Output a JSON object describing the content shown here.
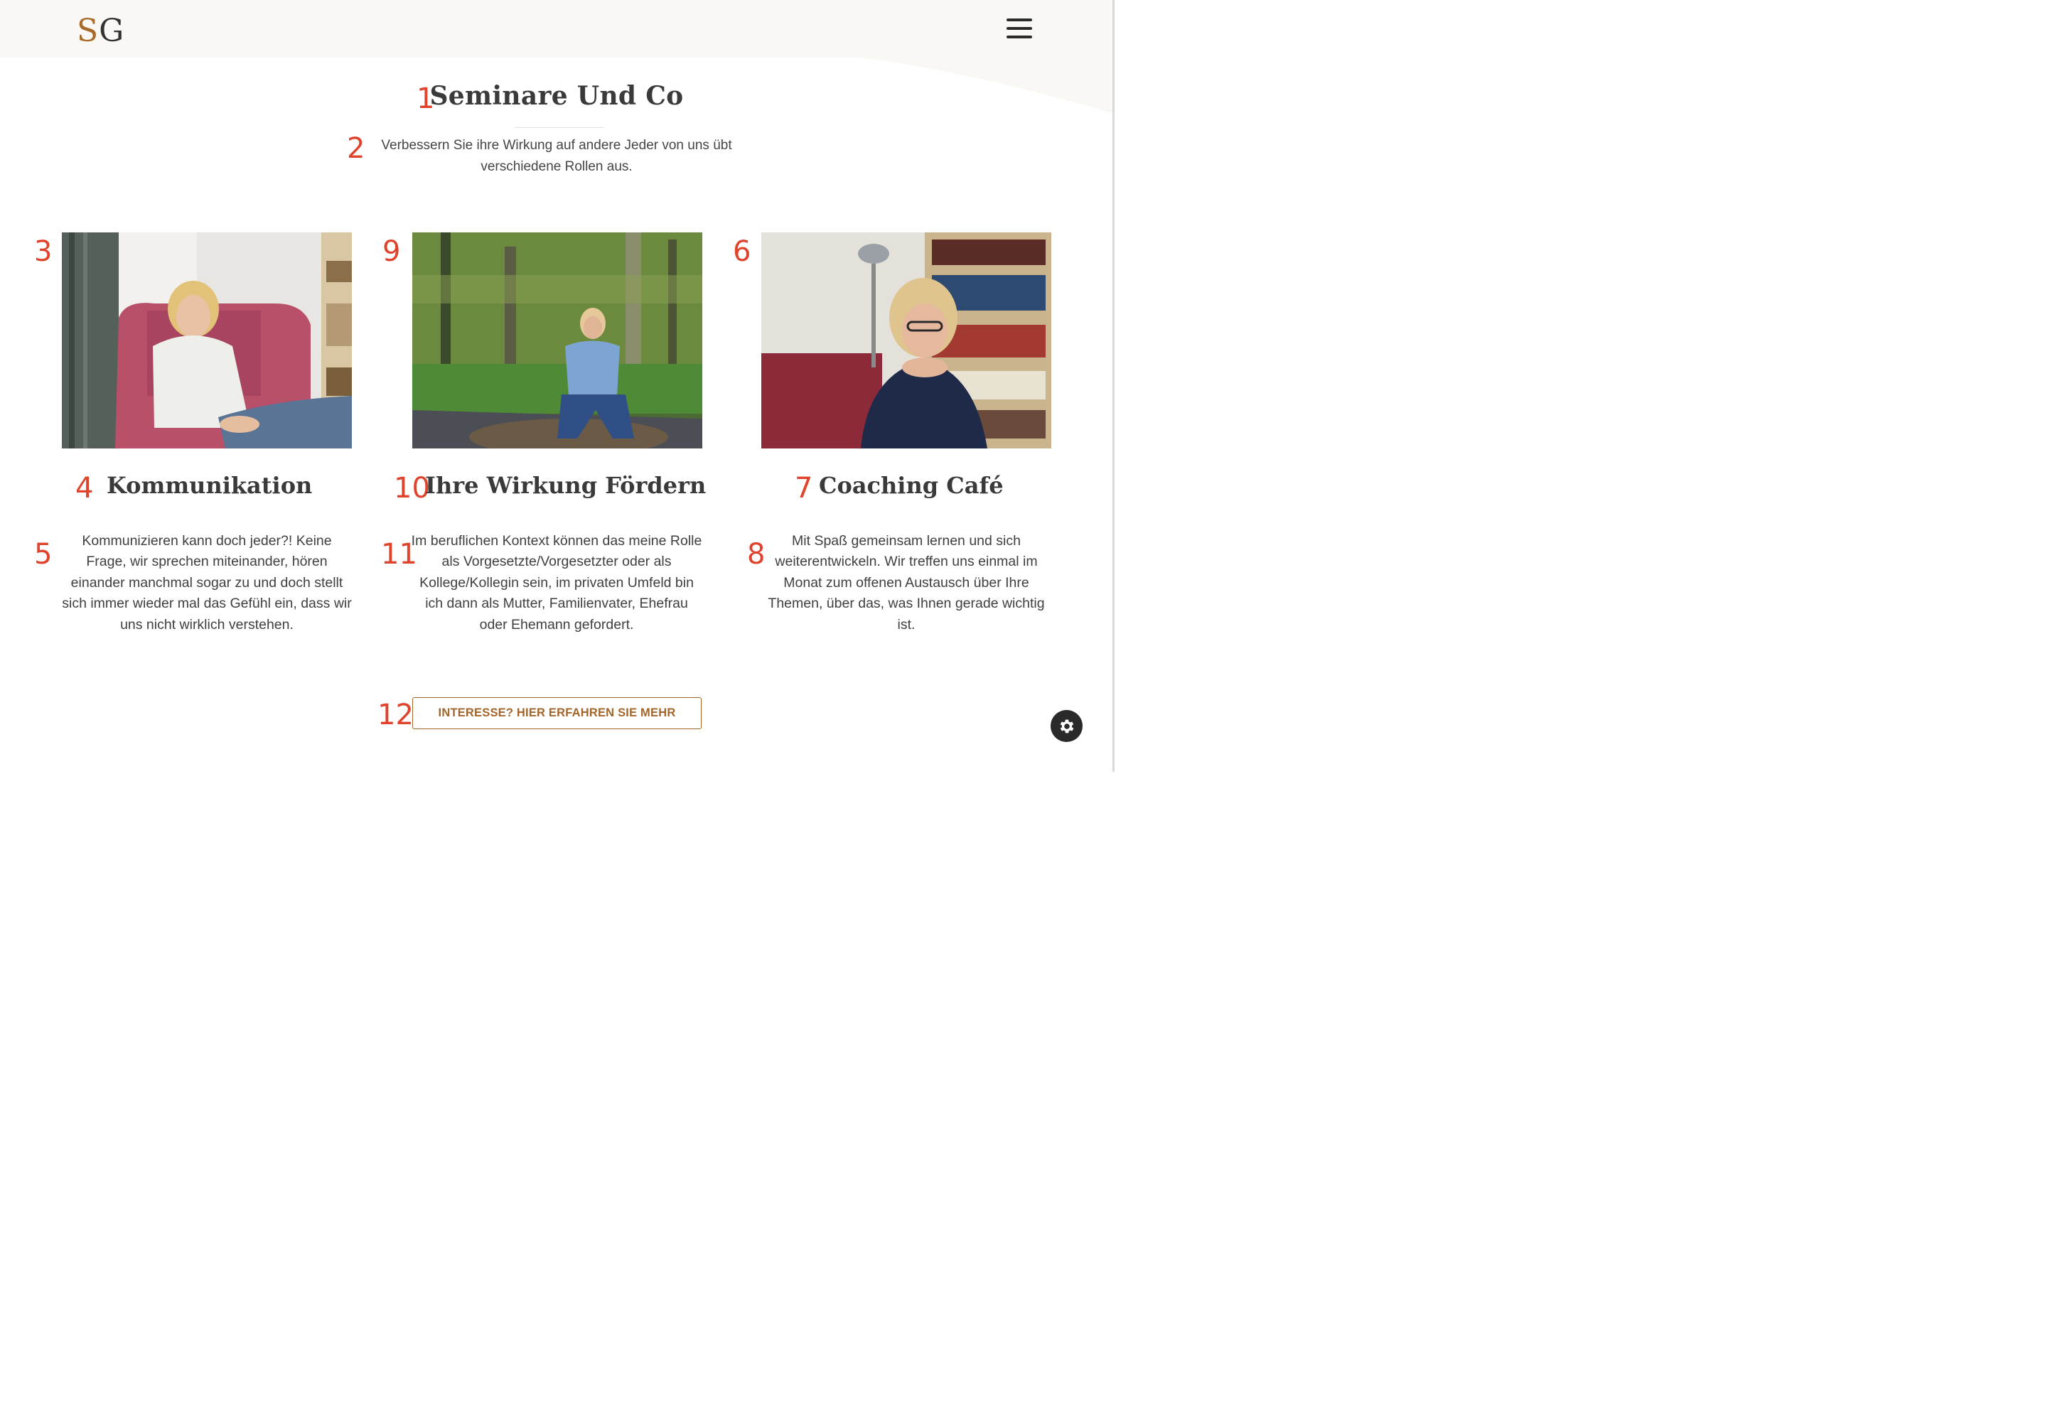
{
  "header": {
    "logo_first": "S",
    "logo_second": "G",
    "menu_icon": "hamburger-menu-icon",
    "bg_color": "#faf8f4",
    "logo_accent": "#a86a2a"
  },
  "markers": {
    "m1": "1",
    "m2": "2",
    "m3": "3",
    "m4": "4",
    "m5": "5",
    "m6": "6",
    "m7": "7",
    "m8": "8",
    "m9": "9",
    "m10": "10",
    "m11": "11",
    "m12": "12",
    "color": "#e0432b"
  },
  "section": {
    "title": "Seminare Und Co",
    "subtitle": "Verbessern Sie ihre Wirkung auf andere Jeder von uns übt verschiedene Rollen aus."
  },
  "cards": [
    {
      "image": "photo-woman-in-red-armchair",
      "title": "Kommunikation",
      "text": "Kommunizieren kann doch jeder?! Keine Frage, wir sprechen miteinander, hören einander manchmal sogar zu und doch stellt sich immer wieder mal das Gefühl ein, dass wir uns nicht wirklich verstehen."
    },
    {
      "image": "photo-woman-sitting-on-rock-outdoors",
      "title": "Ihre Wirkung Fördern",
      "text": "Im beruflichen Kontext können das meine Rolle als Vorgesetzte/Vorgesetzter oder als Kollege/Kollegin sein, im privaten Umfeld bin ich dann als Mutter, Familienvater, Ehefrau oder Ehemann gefordert."
    },
    {
      "image": "photo-woman-with-glasses-bookshelf",
      "title": "Coaching Café",
      "text": "Mit Spaß gemeinsam lernen und sich weiterentwickeln. Wir treffen uns einmal im Monat zum offenen Austausch über Ihre Themen, über das, was Ihnen gerade wichtig ist."
    }
  ],
  "cta": {
    "label": "INTERESSE? HIER ERFAHREN SIE MEHR",
    "color": "#a4652a"
  },
  "settings": {
    "icon": "gear-icon"
  }
}
